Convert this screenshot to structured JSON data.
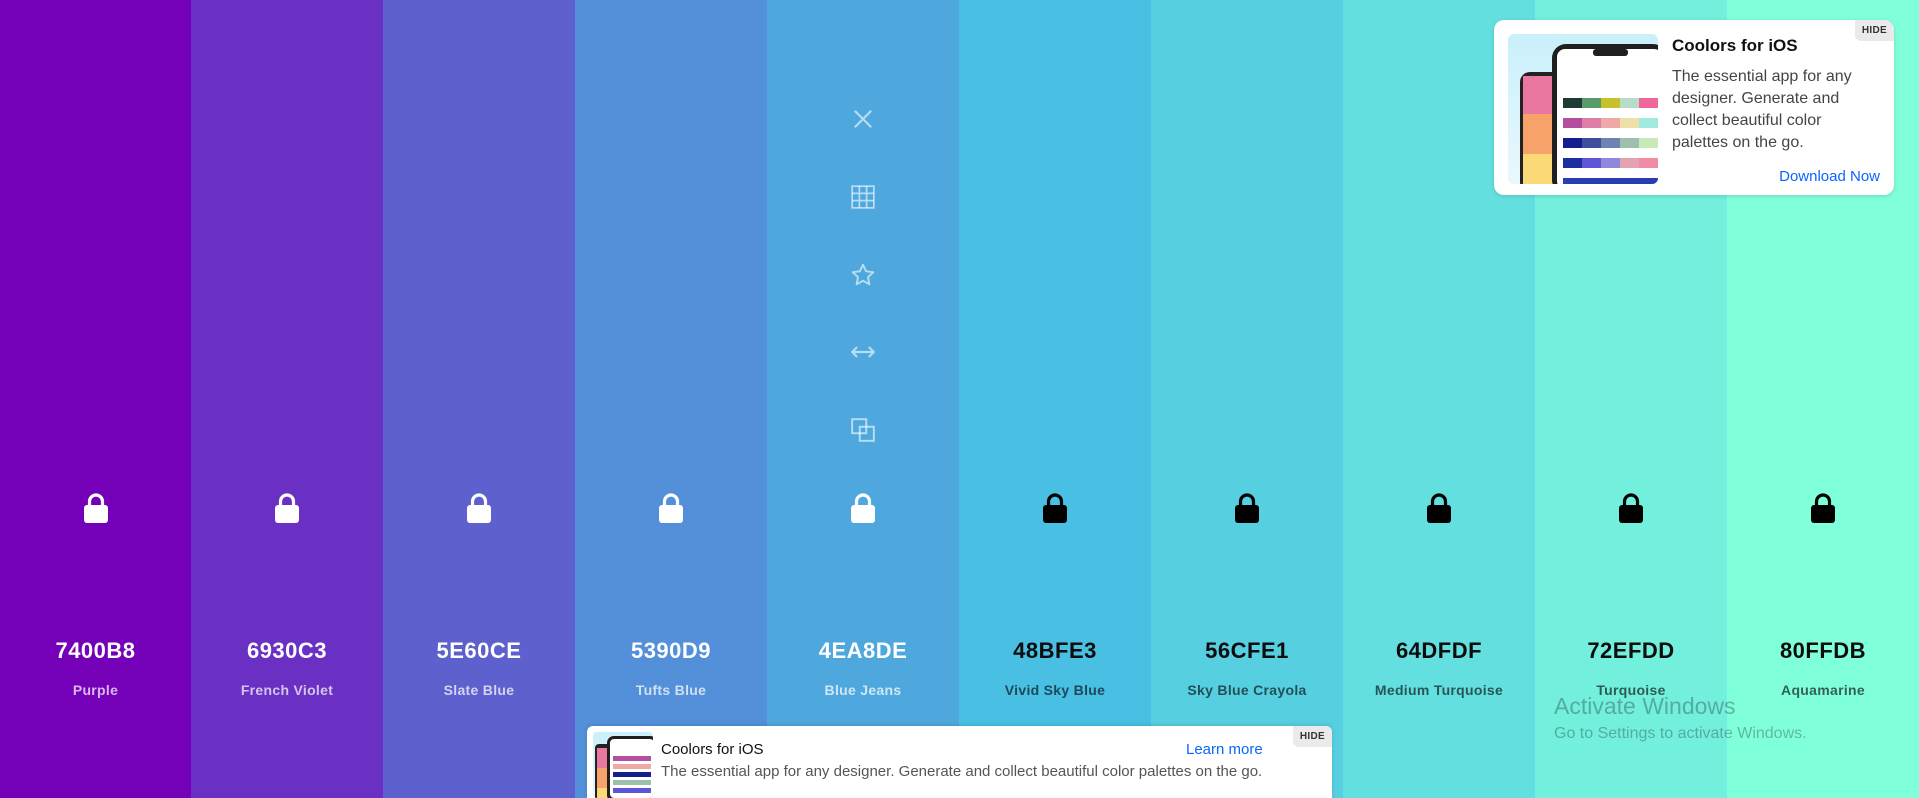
{
  "palette": {
    "swatches": [
      {
        "hex": "7400B8",
        "name": "Purple",
        "color": "#7400B8",
        "text": "light"
      },
      {
        "hex": "6930C3",
        "name": "French Violet",
        "color": "#6930C3",
        "text": "light"
      },
      {
        "hex": "5E60CE",
        "name": "Slate Blue",
        "color": "#5E60CE",
        "text": "light"
      },
      {
        "hex": "5390D9",
        "name": "Tufts Blue",
        "color": "#5390D9",
        "text": "light"
      },
      {
        "hex": "4EA8DE",
        "name": "Blue Jeans",
        "color": "#4EA8DE",
        "text": "light"
      },
      {
        "hex": "48BFE3",
        "name": "Vivid Sky Blue",
        "color": "#48BFE3",
        "text": "dark"
      },
      {
        "hex": "56CFE1",
        "name": "Sky Blue Crayola",
        "color": "#56CFE1",
        "text": "dark"
      },
      {
        "hex": "64DFDF",
        "name": "Medium Turquoise",
        "color": "#64DFDF",
        "text": "dark"
      },
      {
        "hex": "72EFDD",
        "name": "Turquoise",
        "color": "#72EFDD",
        "text": "dark"
      },
      {
        "hex": "80FFDB",
        "name": "Aquamarine",
        "color": "#80FFDB",
        "text": "dark"
      }
    ],
    "hover_tools": [
      "close-icon",
      "shades-grid-icon",
      "favorite-star-icon",
      "drag-arrows-icon",
      "copy-icon"
    ]
  },
  "ad_card": {
    "title": "Coolors for iOS",
    "description": "The essential app for any designer. Generate and collect beautiful color palettes on the go.",
    "cta": "Download Now",
    "hide": "HIDE"
  },
  "ad_bottom": {
    "title": "Coolors for iOS",
    "description": "The essential app for any designer. Generate and collect beautiful color palettes on the go.",
    "cta": "Learn more",
    "hide": "HIDE"
  },
  "watermark": {
    "title": "Activate Windows",
    "subtitle": "Go to Settings to activate Windows."
  }
}
